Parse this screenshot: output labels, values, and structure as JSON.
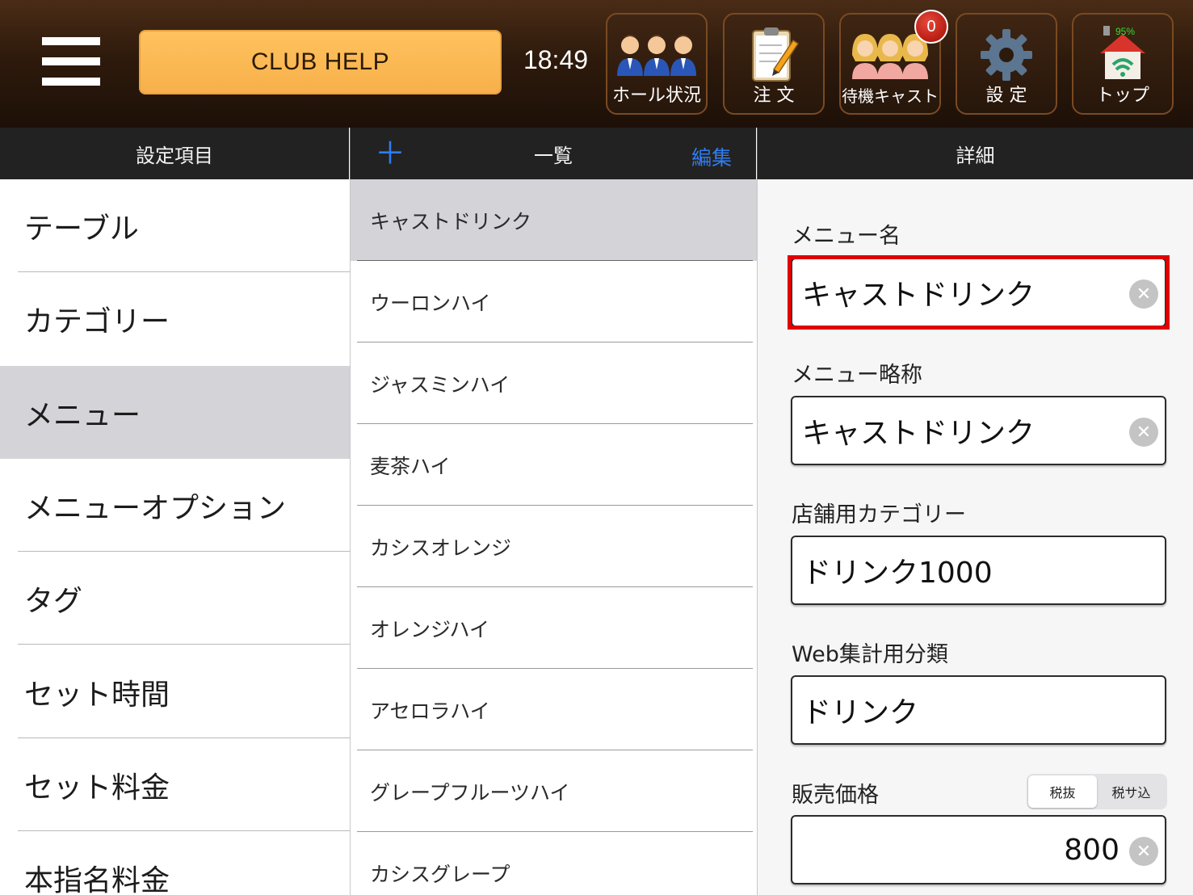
{
  "header": {
    "club_help_label": "CLUB HELP",
    "time": "18:49",
    "nav": [
      {
        "label": "ホール状況",
        "icon": "staff-group-icon"
      },
      {
        "label": "注 文",
        "icon": "clipboard-pencil-icon"
      },
      {
        "label": "待機キャスト",
        "icon": "cast-group-icon"
      },
      {
        "label": "設 定",
        "icon": "gear-icon"
      },
      {
        "label": "トップ",
        "icon": "home-wifi-icon"
      }
    ],
    "waiting_badge": "0",
    "battery_text": "95%"
  },
  "columns": {
    "settings_title": "設定項目",
    "list_title": "一覧",
    "list_add": "＋",
    "list_edit": "編集",
    "detail_title": "詳細"
  },
  "settings_items": [
    "テーブル",
    "カテゴリー",
    "メニュー",
    "メニューオプション",
    "タグ",
    "セット時間",
    "セット料金",
    "本指名料金"
  ],
  "selected_setting": "メニュー",
  "list_items": [
    "キャストドリンク",
    "ウーロンハイ",
    "ジャスミンハイ",
    "麦茶ハイ",
    "カシスオレンジ",
    "オレンジハイ",
    "アセロラハイ",
    "グレープフルーツハイ",
    "カシスグレープ"
  ],
  "selected_list_item": "キャストドリンク",
  "detail": {
    "menu_name_label": "メニュー名",
    "menu_name_value": "キャストドリンク",
    "menu_short_label": "メニュー略称",
    "menu_short_value": "キャストドリンク",
    "store_category_label": "店舗用カテゴリー",
    "store_category_value": "ドリンク1000",
    "web_class_label": "Web集計用分類",
    "web_class_value": "ドリンク",
    "price_label": "販売価格",
    "price_value": "800",
    "tax_options": [
      "税抜",
      "税サ込"
    ],
    "tax_selected": "税抜"
  },
  "colors": {
    "accent_blue": "#2f7cf0",
    "highlight_red": "#e00000",
    "club_help_orange": "#f7b04a"
  }
}
